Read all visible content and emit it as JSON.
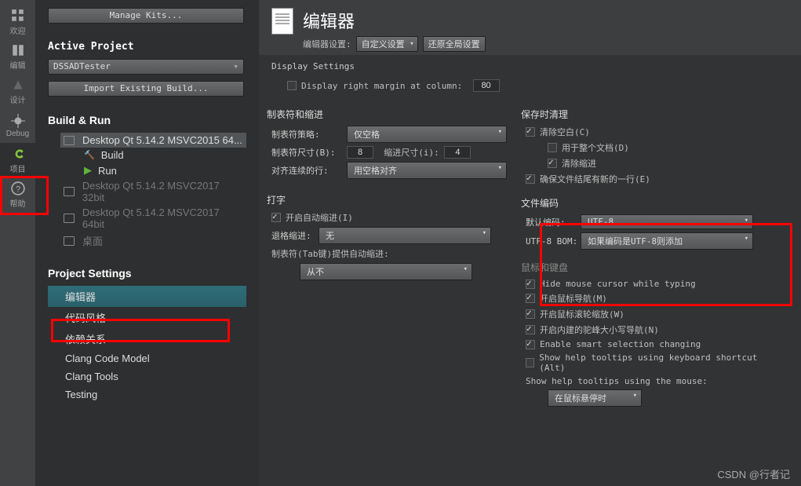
{
  "leftbar": {
    "items": [
      "欢迎",
      "编辑",
      "设计",
      "Debug",
      "项目",
      "帮助"
    ]
  },
  "sidepanel": {
    "manage_kits": "Manage Kits...",
    "active_project_hdr": "Active Project",
    "active_project_value": "DSSADTester",
    "import_build": "Import Existing Build...",
    "build_run_hdr": "Build & Run",
    "kits": [
      {
        "label": "Desktop Qt 5.14.2 MSVC2015 64...",
        "selected": true
      },
      {
        "label": "Desktop Qt 5.14.2 MSVC2017 32bit",
        "disabled": true
      },
      {
        "label": "Desktop Qt 5.14.2 MSVC2017 64bit",
        "disabled": true
      },
      {
        "label": "桌面",
        "disabled": true
      }
    ],
    "build_label": "Build",
    "run_label": "Run",
    "project_settings_hdr": "Project Settings",
    "project_settings": [
      "编辑器",
      "代码风格",
      "依赖关系",
      "Clang Code Model",
      "Clang Tools",
      "Testing"
    ]
  },
  "main": {
    "title": "编辑器",
    "settings_label": "编辑器设置:",
    "settings_value": "自定义设置",
    "restore_global": "还原全局设置",
    "display_settings": "Display Settings",
    "margin_label": "Display right margin at column:",
    "margin_value": "80",
    "tabs_indent_hdr": "制表符和缩进",
    "tab_policy_label": "制表符策略:",
    "tab_policy_value": "仅空格",
    "tab_size_label": "制表符尺寸(B):",
    "tab_size_value": "8",
    "indent_size_label": "缩进尺寸(i):",
    "indent_size_value": "4",
    "align_label": "对齐连续的行:",
    "align_value": "用空格对齐",
    "typing_hdr": "打字",
    "auto_indent": "开启自动缩进(I)",
    "backspace_label": "退格缩进:",
    "backspace_value": "无",
    "tabkey_label": "制表符(Tab键)提供自动缩进:",
    "tabkey_value": "从不",
    "cleanup_hdr": "保存时清理",
    "clean_ws": "清除空白(C)",
    "whole_doc": "用于整个文档(D)",
    "clean_indent": "清除缩进",
    "ensure_newline": "确保文件结尾有新的一行(E)",
    "encoding_hdr": "文件编码",
    "default_enc_label": "默认编码:",
    "default_enc_value": "UTF-8",
    "bom_label": "UTF-8 BOM:",
    "bom_value": "如果编码是UTF-8则添加",
    "mouse_hdr": "鼠标和键盘",
    "hide_cursor": "Hide mouse cursor while typing",
    "mouse_nav": "开启鼠标导航(M)",
    "scroll_zoom": "开启鼠标滚轮缩放(W)",
    "camelcase": "开启内建的驼峰大小写导航(N)",
    "smart_sel": "Enable smart selection changing",
    "tooltip_kbd": "Show help tooltips using keyboard shortcut (Alt)",
    "tooltip_mouse_label": "Show help tooltips using the mouse:",
    "tooltip_mouse_value": "在鼠标悬停时"
  },
  "watermark": "CSDN @行者记"
}
